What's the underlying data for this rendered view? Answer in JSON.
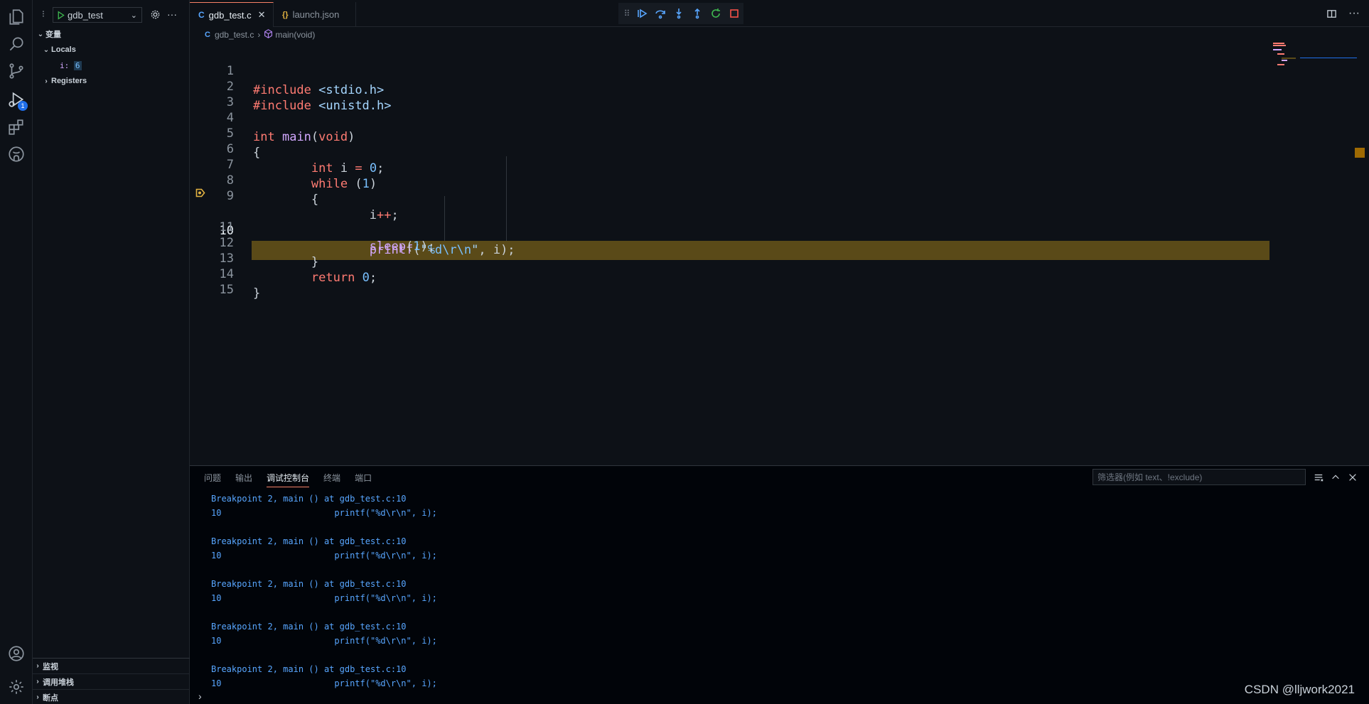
{
  "sidebar": {
    "debug_config": "gdb_test",
    "variables_header": "变量",
    "locals_label": "Locals",
    "var_name": "i:",
    "var_value": "6",
    "registers_label": "Registers",
    "watch_label": "监视",
    "callstack_label": "调用堆栈",
    "breakpoints_label": "断点"
  },
  "activity": {
    "debug_badge": "1"
  },
  "tabs": [
    {
      "label": "gdb_test.c",
      "glyph": "C"
    },
    {
      "label": "launch.json",
      "glyph": "{}"
    }
  ],
  "breadcrumb": {
    "file": "gdb_test.c",
    "symbol": "main(void)",
    "file_glyph": "C"
  },
  "editor": {
    "current_line": 10,
    "line_numbers": [
      "1",
      "2",
      "3",
      "4",
      "5",
      "6",
      "7",
      "8",
      "9",
      "10",
      "11",
      "12",
      "13",
      "14",
      "15"
    ]
  },
  "panel": {
    "tabs": [
      "问题",
      "输出",
      "调试控制台",
      "终端",
      "端口"
    ],
    "active_tab": "调试控制台",
    "filter_placeholder": "筛选器(例如 text、!exclude)",
    "console_blocks": [
      {
        "l1": "Breakpoint 2, main () at gdb_test.c:10",
        "l2": "10\t\t\tprintf(\"%d\\r\\n\", i);"
      },
      {
        "l1": "Breakpoint 2, main () at gdb_test.c:10",
        "l2": "10\t\t\tprintf(\"%d\\r\\n\", i);"
      },
      {
        "l1": "Breakpoint 2, main () at gdb_test.c:10",
        "l2": "10\t\t\tprintf(\"%d\\r\\n\", i);"
      },
      {
        "l1": "Breakpoint 2, main () at gdb_test.c:10",
        "l2": "10\t\t\tprintf(\"%d\\r\\n\", i);"
      },
      {
        "l1": "Breakpoint 2, main () at gdb_test.c:10",
        "l2": "10\t\t\tprintf(\"%d\\r\\n\", i);"
      }
    ],
    "input_prompt": "›"
  },
  "watermark": "CSDN @lljwork2021",
  "colors": {
    "accent": "#f78166",
    "current_line_bg": "#5a4a18",
    "debug_blue": "#58a6ff",
    "debug_green": "#3fb950",
    "debug_red": "#f85149"
  }
}
